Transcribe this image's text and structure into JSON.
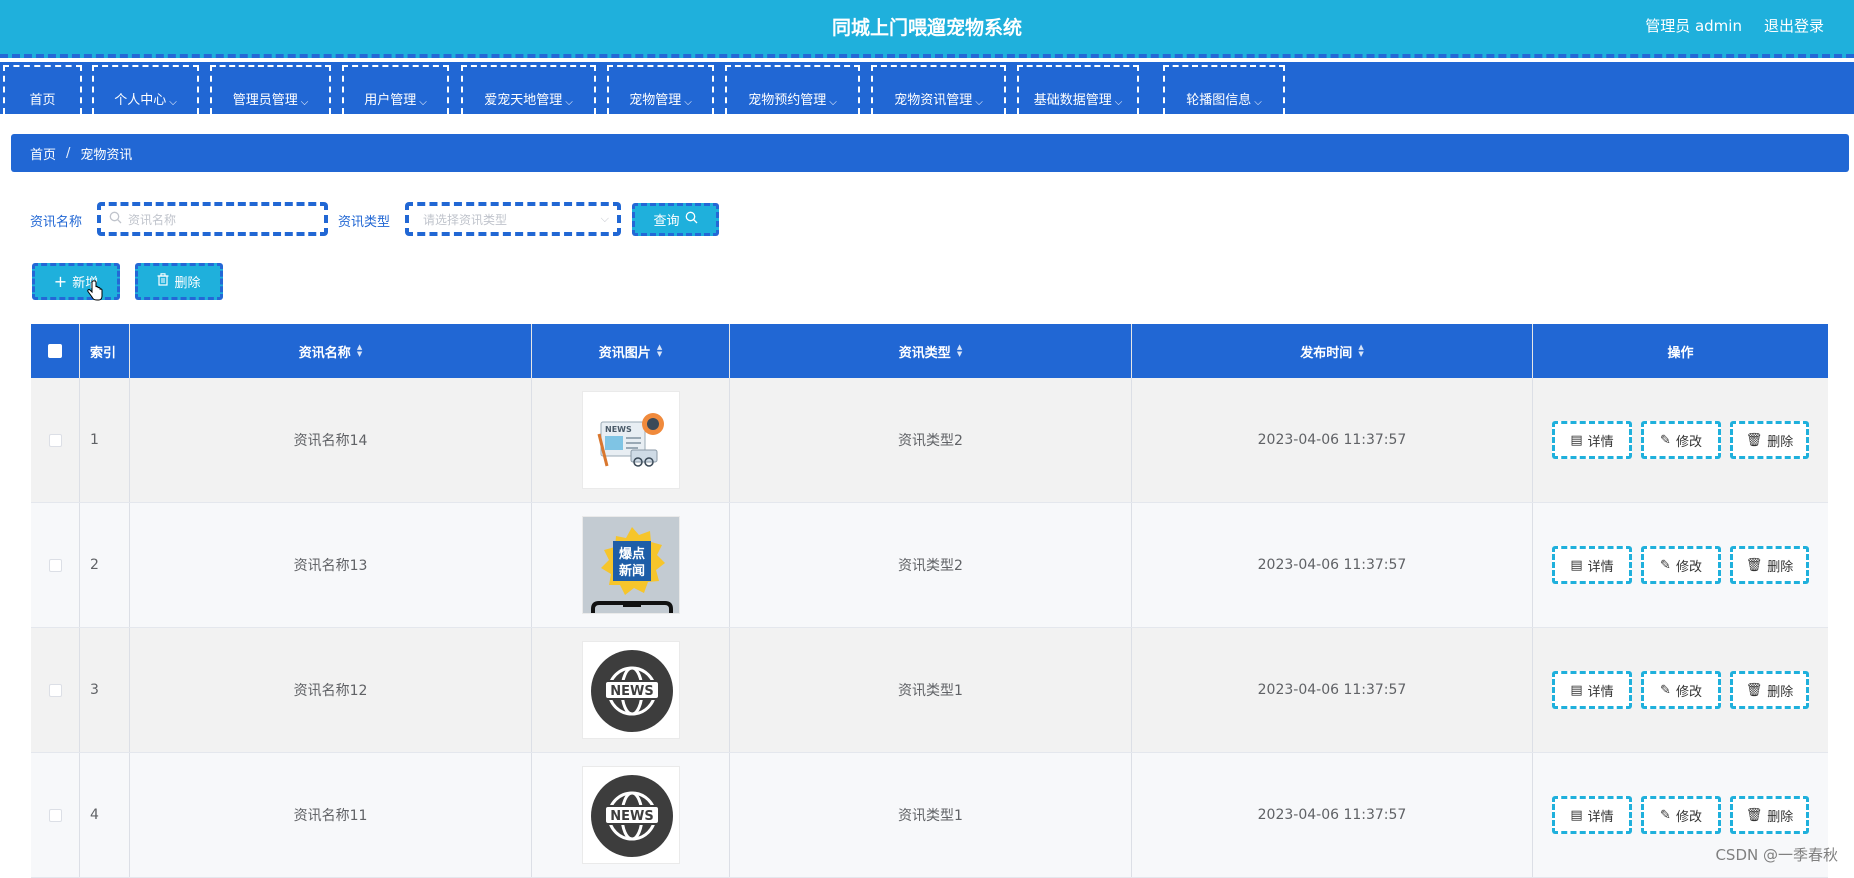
{
  "header": {
    "title": "同城上门喂遛宠物系统",
    "admin_label": "管理员 admin",
    "logout_label": "退出登录"
  },
  "nav": {
    "items": [
      {
        "label": "首页",
        "has_dropdown": false
      },
      {
        "label": "个人中心",
        "has_dropdown": true
      },
      {
        "label": "管理员管理",
        "has_dropdown": true
      },
      {
        "label": "用户管理",
        "has_dropdown": true
      },
      {
        "label": "爱宠天地管理",
        "has_dropdown": true
      },
      {
        "label": "宠物管理",
        "has_dropdown": true
      },
      {
        "label": "宠物预约管理",
        "has_dropdown": true
      },
      {
        "label": "宠物资讯管理",
        "has_dropdown": true
      },
      {
        "label": "基础数据管理",
        "has_dropdown": true
      },
      {
        "label": "轮播图信息",
        "has_dropdown": true
      }
    ]
  },
  "breadcrumb": {
    "home": "首页",
    "separator": "/",
    "current": "宠物资讯"
  },
  "search": {
    "name_label": "资讯名称",
    "name_placeholder": "资讯名称",
    "type_label": "资讯类型",
    "type_placeholder": "请选择资讯类型",
    "query_label": "查询"
  },
  "actions": {
    "add_label": "新增",
    "delete_label": "删除"
  },
  "table": {
    "columns": {
      "index": "索引",
      "name": "资讯名称",
      "image": "资讯图片",
      "type": "资讯类型",
      "time": "发布时间",
      "ops": "操作"
    },
    "rows": [
      {
        "index": "1",
        "name": "资讯名称14",
        "image": "news-illustration",
        "type": "资讯类型2",
        "time": "2023-04-06 11:37:57"
      },
      {
        "index": "2",
        "name": "资讯名称13",
        "image": "hot-news-phone",
        "type": "资讯类型2",
        "time": "2023-04-06 11:37:57"
      },
      {
        "index": "3",
        "name": "资讯名称12",
        "image": "news-globe",
        "type": "资讯类型1",
        "time": "2023-04-06 11:37:57"
      },
      {
        "index": "4",
        "name": "资讯名称11",
        "image": "news-globe",
        "type": "资讯类型1",
        "time": "2023-04-06 11:37:57"
      }
    ],
    "row_actions": {
      "detail": "详情",
      "edit": "修改",
      "delete": "删除"
    }
  },
  "watermark": "CSDN @一季春秋",
  "colors": {
    "header_bg": "#1fb0dc",
    "primary_blue": "#2167d4",
    "button_cyan": "#1fb0dc"
  }
}
